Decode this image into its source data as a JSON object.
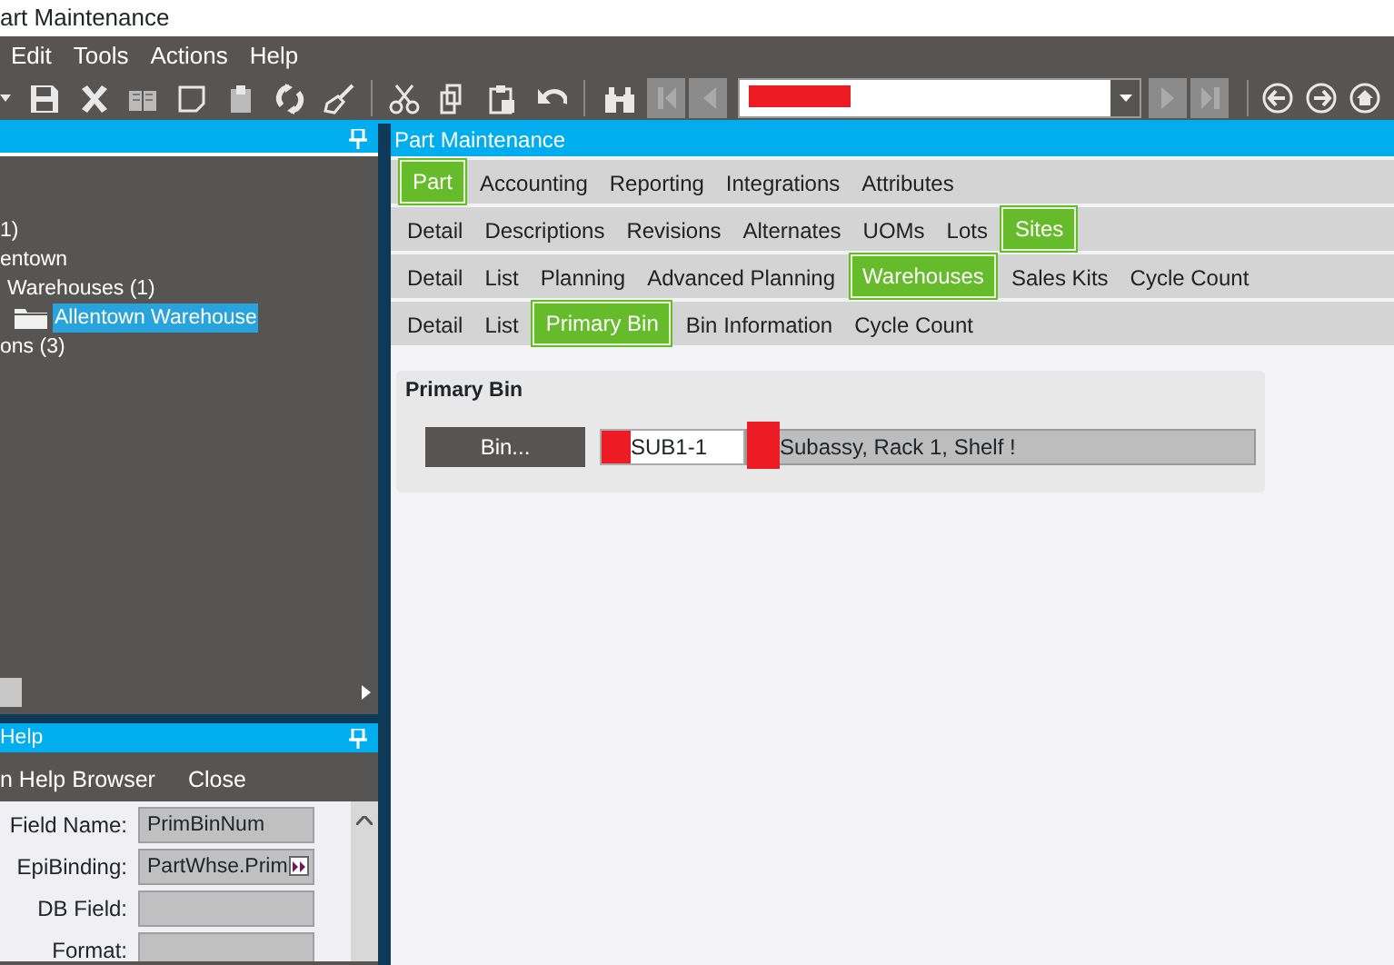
{
  "window": {
    "title": "art Maintenance"
  },
  "menu": [
    "Edit",
    "Tools",
    "Actions",
    "Help"
  ],
  "tree_panel": {
    "items": [
      {
        "label": "1)",
        "selected": false
      },
      {
        "label": "entown",
        "selected": false,
        "children": [
          {
            "label": "Warehouses (1)",
            "selected": false,
            "children": [
              {
                "label": "Allentown Warehouse",
                "selected": true,
                "kind": "folder"
              }
            ]
          }
        ]
      },
      {
        "label": "ons (3)",
        "selected": false
      }
    ]
  },
  "help_panel": {
    "title": "Help",
    "menu": [
      "n Help Browser",
      "Close"
    ],
    "fields": [
      {
        "label": "Field Name:",
        "value": "PrimBinNum"
      },
      {
        "label": "EpiBinding:",
        "value": "PartWhse.Prim",
        "kind": "link"
      },
      {
        "label": "DB Field:"
      },
      {
        "label": "Format:"
      }
    ]
  },
  "main_panel": {
    "title": "Part Maintenance",
    "tab_rows": [
      [
        {
          "label": "Part",
          "selected": true
        },
        {
          "label": "Accounting",
          "selected": false
        },
        {
          "label": "Reporting",
          "selected": false
        },
        {
          "label": "Integrations",
          "selected": false
        },
        {
          "label": "Attributes",
          "selected": false
        }
      ],
      [
        {
          "label": "Detail",
          "selected": false
        },
        {
          "label": "Descriptions",
          "selected": false
        },
        {
          "label": "Revisions",
          "selected": false
        },
        {
          "label": "Alternates",
          "selected": false
        },
        {
          "label": "UOMs",
          "selected": false
        },
        {
          "label": "Lots",
          "selected": false
        },
        {
          "label": "Sites",
          "selected": true
        }
      ],
      [
        {
          "label": "Detail",
          "selected": false
        },
        {
          "label": "List",
          "selected": false
        },
        {
          "label": "Planning",
          "selected": false
        },
        {
          "label": "Advanced Planning",
          "selected": false
        },
        {
          "label": "Warehouses",
          "selected": true
        },
        {
          "label": "Sales Kits",
          "selected": false
        },
        {
          "label": "Cycle Count",
          "selected": false
        }
      ],
      [
        {
          "label": "Detail",
          "selected": false
        },
        {
          "label": "List",
          "selected": false
        },
        {
          "label": "Primary Bin",
          "selected": true
        },
        {
          "label": "Bin Information",
          "selected": false
        },
        {
          "label": "Cycle Count",
          "selected": false
        }
      ]
    ],
    "group": {
      "title": "Primary Bin",
      "button": "Bin...",
      "bin_value": "SUB1-1",
      "description": "Subassy, Rack 1, Shelf !"
    }
  }
}
